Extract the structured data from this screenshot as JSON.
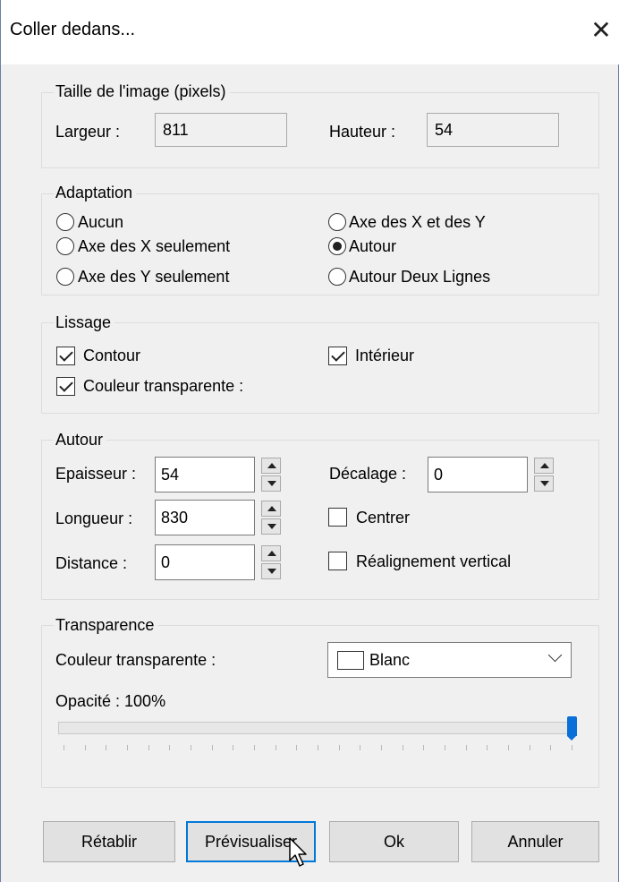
{
  "window": {
    "title": "Coller dedans...",
    "close_glyph": "✕"
  },
  "image_size": {
    "legend": "Taille de l'image (pixels)",
    "width_label": "Largeur :",
    "width_value": "811",
    "height_label": "Hauteur :",
    "height_value": "54"
  },
  "adaptation": {
    "legend": "Adaptation",
    "options": [
      {
        "label": "Aucun",
        "selected": false
      },
      {
        "label": "Axe des X seulement",
        "selected": false
      },
      {
        "label": "Axe des Y seulement",
        "selected": false
      },
      {
        "label": "Axe des X et des Y",
        "selected": false
      },
      {
        "label": "Autour",
        "selected": true
      },
      {
        "label": "Autour Deux Lignes",
        "selected": false
      }
    ]
  },
  "lissage": {
    "legend": "Lissage",
    "contour": {
      "label": "Contour",
      "checked": true
    },
    "interieur": {
      "label": "Intérieur",
      "checked": true
    },
    "transparent": {
      "label": "Couleur transparente :",
      "checked": true
    }
  },
  "autour": {
    "legend": "Autour",
    "epaisseur_label": "Epaisseur :",
    "epaisseur_value": "54",
    "longueur_label": "Longueur :",
    "longueur_value": "830",
    "distance_label": "Distance :",
    "distance_value": "0",
    "decalage_label": "Décalage :",
    "decalage_value": "0",
    "centrer": {
      "label": "Centrer",
      "checked": false
    },
    "realign": {
      "label": "Réalignement vertical",
      "checked": false
    }
  },
  "transparence": {
    "legend": "Transparence",
    "color_label": "Couleur transparente :",
    "color_value": "Blanc",
    "opacity_label": "Opacité : 100%",
    "opacity_percent": 100,
    "tick_count": 25
  },
  "buttons": {
    "reset": "Rétablir",
    "preview": "Prévisualiser",
    "ok": "Ok",
    "cancel": "Annuler"
  },
  "colors": {
    "accent": "#0078d7",
    "slider_thumb": "#0a6fd8",
    "background": "#f0f0f0"
  }
}
